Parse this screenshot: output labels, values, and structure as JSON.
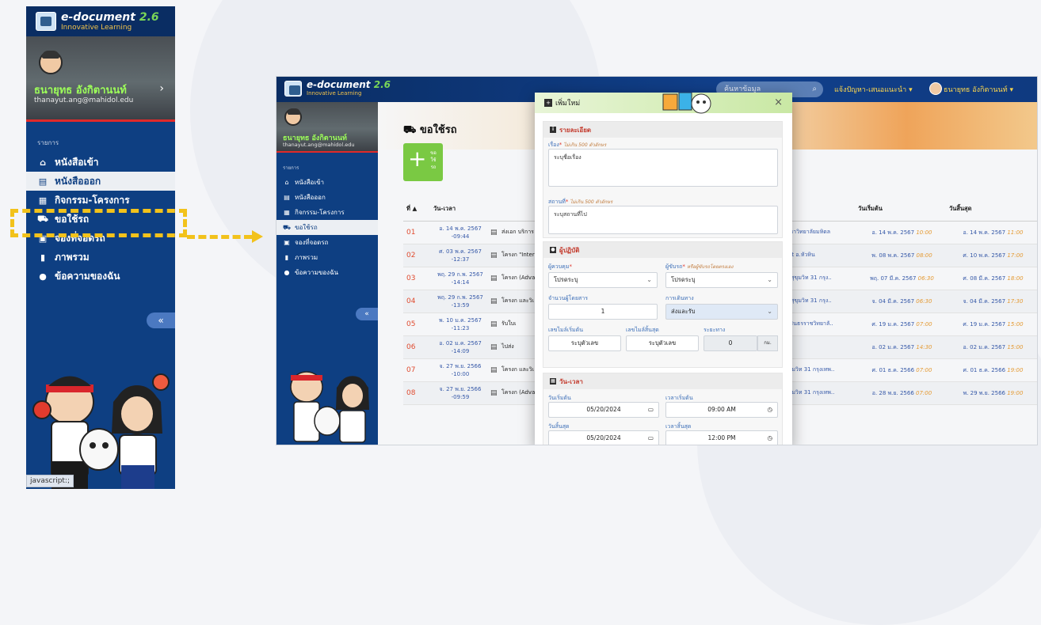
{
  "brand": {
    "title": "e-document",
    "version": "2.6",
    "subtitle": "Innovative Learning"
  },
  "user": {
    "name": "ธนายุทธ อังกิตานนท์",
    "email": "thanayut.ang@mahidol.edu"
  },
  "sidebar": {
    "section": "รายการ",
    "items": [
      {
        "label": "หนังสือเข้า",
        "icon": "inbox-icon",
        "glyph": "⌂"
      },
      {
        "label": "หนังสือออก",
        "icon": "document-icon",
        "glyph": "▤"
      },
      {
        "label": "กิจกรรม-โครงการ",
        "icon": "calendar-icon",
        "glyph": "▦"
      },
      {
        "label": "ขอใช้รถ",
        "icon": "car-icon",
        "glyph": "⛟"
      },
      {
        "label": "จองที่จอดรถ",
        "icon": "parking-icon",
        "glyph": "▣"
      },
      {
        "label": "ภาพรวม",
        "icon": "bar-chart-icon",
        "glyph": "▮"
      },
      {
        "label": "ข้อความของฉัน",
        "icon": "chat-icon",
        "glyph": "●"
      }
    ],
    "collapse": "«"
  },
  "status_hint": "javascript:;",
  "topbar": {
    "search_placeholder": "ค้นหาข้อมูล",
    "user1": "แจ้งปัญหา-เสนอแนะนำ ▾",
    "user2": "ธนายุทธ อังกิตานนท์ ▾"
  },
  "page": {
    "title": "⛟ ขอใช้รถ",
    "add_label": "ขอ ใช้ รถ",
    "table": {
      "headers": [
        "ที่ ▲",
        "วัน-เวลา",
        "",
        "",
        "สถานที่",
        "วันเริ่มต้น",
        "วันสิ้นสุด"
      ],
      "rows": [
        {
          "no": "01",
          "dt": "อ. 14 พ.ค. 2567",
          "t": "-09:44",
          "subj": "ส่งเอก บริการ",
          "place": "ารบดี มหาวิทยาลัยมหิดล",
          "start": "อ. 14 พ.ค. 2567",
          "st": "10:00",
          "end": "อ. 14 พ.ค. 2567",
          "et": "11:00"
        },
        {
          "no": "02",
          "dt": "ศ. 03 พ.ค. 2567",
          "t": "-12:37",
          "subj": "โครงก \"Inter",
          "place": "n Resort อ.หัวหิน",
          "start": "พ. 08 พ.ค. 2567",
          "st": "08:00",
          "end": "ศ. 10 พ.ค. 2567",
          "et": "17:00"
        },
        {
          "no": "03",
          "dt": "พฤ. 29 ก.พ. 2567",
          "t": "-14:14",
          "subj": "โครงก (Adva",
          "place": "กรุงเทพ สุขุมวิท 31 กรุง..",
          "start": "พฤ. 07 มี.ค. 2567",
          "st": "06:30",
          "end": "ศ. 08 มี.ค. 2567",
          "et": "18:00"
        },
        {
          "no": "04",
          "dt": "พฤ. 29 ก.พ. 2567",
          "t": "-13:59",
          "subj": "โครงก และวิเ",
          "place": "กรุงเทพ สุขุมวิท 31 กรุง..",
          "start": "จ. 04 มี.ค. 2567",
          "st": "06:30",
          "end": "จ. 04 มี.ค. 2567",
          "et": "17:30"
        },
        {
          "no": "05",
          "dt": "พ. 10 ม.ค. 2567 -11:23",
          "t": "",
          "subj": "รับใบเ",
          "place": "ยาลองศิรินธรราชวิทยาลั..",
          "start": "ศ. 19 ม.ค. 2567",
          "st": "07:00",
          "end": "ศ. 19 ม.ค. 2567",
          "et": "15:00"
        },
        {
          "no": "06",
          "dt": "อ. 02 ม.ค. 2567",
          "t": "-14:09",
          "subj": "ไปส่ง",
          "place": "แมนทล",
          "start": "อ. 02 ม.ค. 2567",
          "st": "14:30",
          "end": "อ. 02 ม.ค. 2567",
          "et": "15:00"
        },
        {
          "no": "07",
          "dt": "จ. 27 พ.ย. 2566",
          "t": "-10:00",
          "subj": "โครงก และวิเ",
          "place": "งเทพ สุขุมวิท 31 กรุงเทพ..",
          "start": "ศ. 01 ธ.ค. 2566",
          "st": "07:00",
          "end": "ศ. 01 ธ.ค. 2566",
          "et": "19:00"
        },
        {
          "no": "08",
          "dt": "จ. 27 พ.ย. 2566",
          "t": "-09:59",
          "subj": "โครงก (Adva",
          "place": "งเทพ สุขุมวิท 31 กรุงเทพ..",
          "start": "อ. 28 พ.ย. 2566",
          "st": "07:00",
          "end": "พ. 29 พ.ย. 2566",
          "et": "19:00"
        }
      ]
    }
  },
  "modal": {
    "title": "เพิ่มใหม่",
    "close": "×",
    "sec_detail": "รายละเอียด",
    "subject_label": "เรื่อง",
    "subject_hint": "ไม่เกิน 500 ตัวอักษร",
    "subject_placeholder": "ระบุชื่อเรื่อง",
    "place_label": "สถานที่",
    "place_hint": "ไม่เกิน 500 ตัวอักษร",
    "place_placeholder": "ระบุสถานที่ไป",
    "sec_operator": "ผู้ปฏิบัติ",
    "controller_label": "ผู้ควบคุม",
    "driver_label": "ผู้ขับรถ",
    "driver_hint": "หรือผู้ขับรถโดยตรงเอง",
    "controller_value": "โปรดระบุ",
    "driver_value": "โปรดระบุ",
    "passengers_label": "จำนวนผู้โดยสาร",
    "passengers_value": "1",
    "travel_label": "การเดินทาง",
    "travel_value": "ส่งและรับ",
    "mile_start_label": "เลขไมล์เริ่มต้น",
    "mile_end_label": "เลขไมล์สิ้นสุด",
    "distance_label": "ระยะทาง",
    "mile_start_placeholder": "ระบุตัวเลข",
    "mile_end_placeholder": "ระบุตัวเลข",
    "distance_value": "0",
    "distance_unit": "กม.",
    "sec_datetime": "วัน-เวลา",
    "start_date_label": "วันเริ่มต้น",
    "start_time_label": "เวลาเริ่มต้น",
    "start_date": "05/20/2024",
    "start_time": "09:00 AM",
    "end_date_label": "วันสิ้นสุด",
    "end_time_label": "เวลาสิ้นสุด",
    "end_date": "05/20/2024",
    "end_time": "12:00 PM"
  }
}
